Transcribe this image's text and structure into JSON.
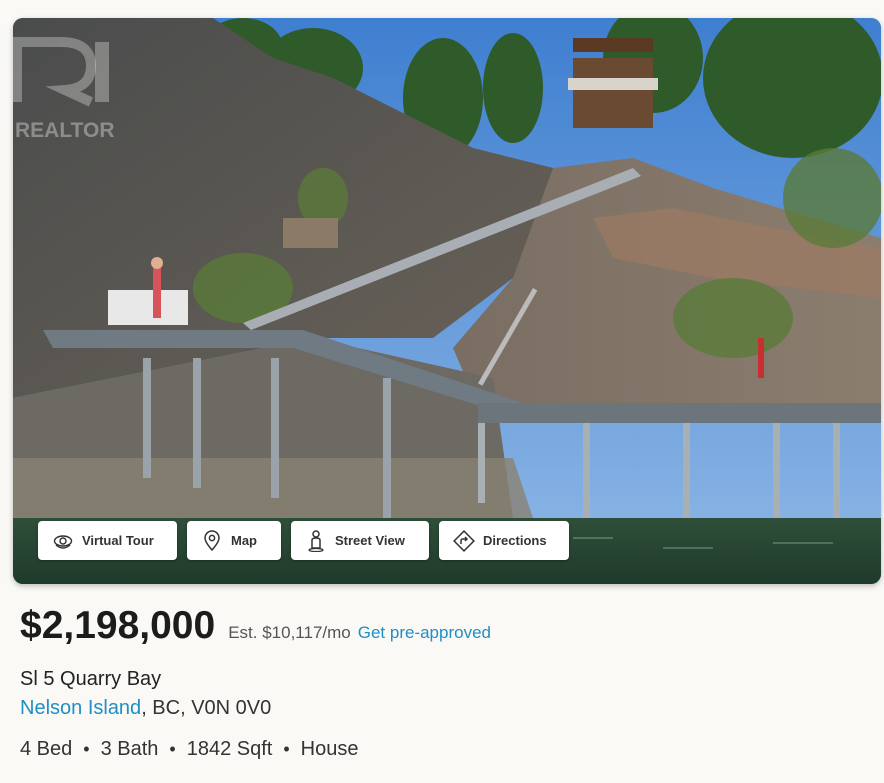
{
  "photo": {
    "watermark": "REALTOR",
    "buttons": [
      {
        "label": "Virtual Tour",
        "icon": "virtual-tour-icon"
      },
      {
        "label": "Map",
        "icon": "map-pin-icon"
      },
      {
        "label": "Street View",
        "icon": "street-view-person-icon"
      },
      {
        "label": "Directions",
        "icon": "directions-icon"
      }
    ]
  },
  "listing": {
    "price": "$2,198,000",
    "estimate": "Est. $10,117/mo",
    "preapproved_label": "Get pre-approved",
    "street": "Sl 5 Quarry Bay",
    "city": "Nelson Island",
    "region_postal": ", BC, V0N 0V0",
    "beds": "4 Bed",
    "baths": "3 Bath",
    "sqft": "1842 Sqft",
    "type": "House",
    "separator": "•"
  },
  "colors": {
    "link": "#1f8fc4",
    "button_bg": "#ffffff",
    "page_bg": "#faf9f6"
  }
}
